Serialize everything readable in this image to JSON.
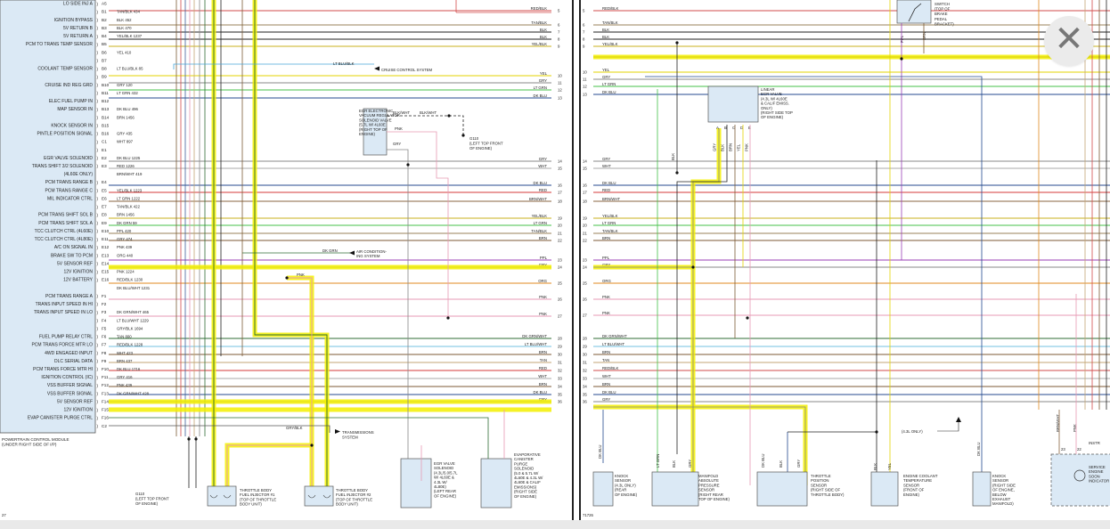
{
  "viewer": {
    "close_icon": "close-icon",
    "close_glyph": "✕"
  },
  "left": {
    "pcm_labels": [
      {
        "t": "LO SIDE INJ A",
        "pin": "A5"
      },
      {
        "t": "",
        "pin": "B1"
      },
      {
        "t": "IGNITION BYPASS",
        "pin": "B2"
      },
      {
        "t": "5V RETURN B",
        "pin": "B3"
      },
      {
        "t": "5V RETURN A",
        "pin": "B4"
      },
      {
        "t": "PCM TO TRANS TEMP SENSOR",
        "pin": "B5"
      },
      {
        "t": "",
        "pin": "B6"
      },
      {
        "t": "",
        "pin": "B7"
      },
      {
        "t": "COOLANT TEMP SENSOR",
        "pin": "B8"
      },
      {
        "t": "",
        "pin": "B9"
      },
      {
        "t": "CRUISE IND REG GRD",
        "pin": "B10"
      },
      {
        "t": "",
        "pin": "B11"
      },
      {
        "t": "ELEC FUEL PUMP IN",
        "pin": "B12"
      },
      {
        "t": "MAP SENSOR IN",
        "pin": "B13"
      },
      {
        "t": "",
        "pin": "B14"
      },
      {
        "t": "KNOCK SENSOR IN",
        "pin": "B15"
      },
      {
        "t": "PINTLE POSITION SIGNAL",
        "pin": "B16"
      },
      {
        "t": "",
        "pin": "C1"
      },
      {
        "t": "",
        "pin": "E1"
      },
      {
        "t": "EGR VALVE SOLENOID",
        "pin": "E2"
      },
      {
        "t": "TRANS SHIFT 3/2 SOLENOID",
        "pin": "E3"
      },
      {
        "t": "(4L60E ONLY)",
        "pin": ""
      },
      {
        "t": "PCM TRANS RANGE B",
        "pin": "E4"
      },
      {
        "t": "PCM TRANS RANGE C",
        "pin": "E5"
      },
      {
        "t": "MIL INDICATOR CTRL",
        "pin": "E6"
      },
      {
        "t": "",
        "pin": "E7"
      },
      {
        "t": "PCM TRANS SHIFT SOL B",
        "pin": "E8"
      },
      {
        "t": "PCM TRANS SHIFT SOL A",
        "pin": "E9"
      },
      {
        "t": "TCC CLUTCH CTRL (4L60E)",
        "pin": "E10"
      },
      {
        "t": "TCC CLUTCH CTRL (4L80E)",
        "pin": "E11"
      },
      {
        "t": "A/C ON SIGNAL IN",
        "pin": "E12"
      },
      {
        "t": "BRAKE SW TO PCM",
        "pin": "E13"
      },
      {
        "t": "5V SENSOR REF",
        "pin": "E14"
      },
      {
        "t": "12V IGNITION",
        "pin": "E15"
      },
      {
        "t": "12V BATTERY",
        "pin": "E16"
      },
      {
        "t": "",
        "pin": ""
      },
      {
        "t": "PCM TRANS RANGE A",
        "pin": "F1"
      },
      {
        "t": "TRANS INPUT SPEED IN HI",
        "pin": "F2"
      },
      {
        "t": "TRANS INPUT SPEED IN LO",
        "pin": "F3"
      },
      {
        "t": "",
        "pin": "F4"
      },
      {
        "t": "",
        "pin": "F5"
      },
      {
        "t": "FUEL PUMP RELAY CTRL",
        "pin": "F6"
      },
      {
        "t": "PCM TRANS FORCE MTR LO",
        "pin": "F7"
      },
      {
        "t": "4WD ENGAGED INPUT",
        "pin": "F8"
      },
      {
        "t": "DLC SERIAL DATA",
        "pin": "F9"
      },
      {
        "t": "PCM TRANS FORCE MTR HI",
        "pin": "F10"
      },
      {
        "t": "IGNITION CONTROL (IC)",
        "pin": "F11"
      },
      {
        "t": "VSS BUFFER SIGNAL",
        "pin": "F12"
      },
      {
        "t": "VSS BUFFER SIGNAL",
        "pin": "F13"
      },
      {
        "t": "5V SENSOR REF",
        "pin": "F14"
      },
      {
        "t": "12V IGNITION",
        "pin": "F15"
      },
      {
        "t": "EVAP CANISTER PURGE CTRL",
        "pin": "F16"
      },
      {
        "t": "",
        "pin": "C2"
      }
    ],
    "wire_labels": [
      "TAN/BLK 434",
      "BLK 452",
      "BLK 470",
      "YEL/BLK 1237",
      "",
      "YEL 410",
      "",
      "LT BLU/BLK 85",
      "",
      "GRY 120",
      "LT GRN 432",
      "",
      "DK BLU 496",
      "BRN 1456",
      "",
      "GRY 435",
      "WHT 897",
      "",
      "DK BLU 1225",
      "RED 1226",
      "BRN/WHT 419",
      "",
      "YEL/BLK 1223",
      "LT GRN 1222",
      "TAN/BLK 422",
      "BRN 1456",
      "DK GRN 59",
      "PPL 420",
      "GRY 474",
      "PNK 439",
      "ORG 440",
      "",
      "PNK 1224",
      "RED/BLK 1230",
      "DK BLU/WHT 1231",
      "",
      "",
      "DK GRN/WHT 465",
      "LT BLU/WHT 1229",
      "GRY/BLK 1694",
      "TAN 800",
      "RED/BLK 1228",
      "WHT 423",
      "BRN 437",
      "DK BLU 1716",
      "GRY 416",
      "PNK 439",
      "DK GRN/WHT 428"
    ],
    "right_colors": [
      {
        "c": "RED/BLK",
        "n": "5"
      },
      {
        "c": "TAN/BLK",
        "n": "6"
      },
      {
        "c": "BLK",
        "n": "7"
      },
      {
        "c": "BLK",
        "n": "8"
      },
      {
        "c": "YEL/BLK",
        "n": "9"
      },
      {
        "c": "YEL",
        "n": "10"
      },
      {
        "c": "GRY",
        "n": "11"
      },
      {
        "c": "LT GRN",
        "n": "12"
      },
      {
        "c": "DK BLU",
        "n": "13"
      },
      {
        "c": "GRY",
        "n": "14"
      },
      {
        "c": "WHT",
        "n": "15"
      },
      {
        "c": "DK BLU",
        "n": "16"
      },
      {
        "c": "RED",
        "n": "17"
      },
      {
        "c": "BRN/WHT",
        "n": "18"
      },
      {
        "c": "YEL/BLK",
        "n": "19"
      },
      {
        "c": "LT GRN",
        "n": "20"
      },
      {
        "c": "TAN/BLK",
        "n": "21"
      },
      {
        "c": "BRN",
        "n": "22"
      },
      {
        "c": "PPL",
        "n": "23"
      },
      {
        "c": "GRY",
        "n": "24"
      },
      {
        "c": "ORG",
        "n": "25"
      },
      {
        "c": "PNK",
        "n": "26"
      },
      {
        "c": "PNK",
        "n": "27"
      },
      {
        "c": "DK GRN/WHT",
        "n": "28"
      },
      {
        "c": "LT BLU/WHT",
        "n": "29"
      },
      {
        "c": "BRN",
        "n": "30"
      },
      {
        "c": "TAN",
        "n": "31"
      },
      {
        "c": "RED",
        "n": "32"
      },
      {
        "c": "WHT",
        "n": "33"
      },
      {
        "c": "BRN",
        "n": "34"
      },
      {
        "c": "DK BLU",
        "n": "35"
      },
      {
        "c": "GRY",
        "n": "36"
      }
    ],
    "cruise": "LT BLU/BLK",
    "cruise_sys": "CRUISE CONTROL SYSTEM",
    "egr_vac_title": [
      "EGR ELECTRONIC",
      "VACUUM REGULATOR",
      "SOLENOID VALVE",
      "(5.7L W/ 4L60E",
      "(RIGHT TOP OF",
      "ENGINE)"
    ],
    "blkwht": "BLK/WHT",
    "pnk": "PNK",
    "gry": "GRY",
    "g110_right": [
      "G110",
      "(LEFT TOP FRONT",
      "OF ENGINE)"
    ],
    "dkgrn": "DK GRN",
    "ac_sys": [
      "AIR CONDITION-",
      "ING SYSTEM"
    ],
    "grybk": "GRY/BLK",
    "trans_sys": [
      "TRANSMISSIONS",
      "SYSTEM"
    ],
    "pcm_caption": [
      "POWERTRAIN CONTROL MODULE",
      "(UNDER RIGHT SIDE OF I/P)"
    ],
    "g110_left": [
      "G110",
      "(LEFT TOP FRONT",
      "OF ENGINE)"
    ],
    "inj1": [
      "THROTTLE BODY",
      "FUEL INJECTOR #1",
      "(TOP OF THROTTLE",
      "BODY UNIT)"
    ],
    "inj2": [
      "THROTTLE BODY",
      "FUEL INJECTOR #2",
      "(TOP OF THROTTLE",
      "BODY UNIT)"
    ],
    "egr_sol": [
      "EGR VALVE",
      "SOLENOID",
      "(4.3L/5.0/5.7L",
      "W/ 4L60E &",
      "4.3L W/",
      "4L80E)",
      "(LEFT REAR",
      "OF ENGINE)"
    ],
    "evap": [
      "EVAPORATIVE",
      "CANISTER",
      "PURGE",
      "SOLENOID",
      "(5.0 & 5.7L W/",
      "4L60E & 4.3L W/",
      "4L60E & CALIF",
      "EMISSIONS)",
      "(RIGHT SIDE",
      "OF ENGINE)"
    ],
    "page_num": "27"
  },
  "right": {
    "left_colors": [
      {
        "c": "RED/BLK",
        "n": "5"
      },
      {
        "c": "TAN/BLK",
        "n": "6"
      },
      {
        "c": "BLK",
        "n": "7"
      },
      {
        "c": "BLK",
        "n": "8"
      },
      {
        "c": "YEL/BLK",
        "n": "9"
      },
      {
        "c": "YEL",
        "n": "10"
      },
      {
        "c": "GRY",
        "n": "11"
      },
      {
        "c": "LT GRN",
        "n": "12"
      },
      {
        "c": "DK BLU",
        "n": "13"
      },
      {
        "c": "GRY",
        "n": "14"
      },
      {
        "c": "WHT",
        "n": "15"
      },
      {
        "c": "DK BLU",
        "n": "16"
      },
      {
        "c": "RED",
        "n": "17"
      },
      {
        "c": "BRN/WHT",
        "n": "18"
      },
      {
        "c": "YEL/BLK",
        "n": "19"
      },
      {
        "c": "LT GRN",
        "n": "20"
      },
      {
        "c": "TAN/BLK",
        "n": "21"
      },
      {
        "c": "BRN",
        "n": "22"
      },
      {
        "c": "PPL",
        "n": "23"
      },
      {
        "c": "GRY",
        "n": "24"
      },
      {
        "c": "ORG",
        "n": "25"
      },
      {
        "c": "PNK",
        "n": "26"
      },
      {
        "c": "PNK",
        "n": "27"
      },
      {
        "c": "DK GRN/WHT",
        "n": "28"
      },
      {
        "c": "LT BLU/WHT",
        "n": "29"
      },
      {
        "c": "BRN",
        "n": "30"
      },
      {
        "c": "TAN",
        "n": "31"
      },
      {
        "c": "RED/BLK",
        "n": "32"
      },
      {
        "c": "WHT",
        "n": "33"
      },
      {
        "c": "BRN",
        "n": "34"
      },
      {
        "c": "DK BLU",
        "n": "35"
      },
      {
        "c": "GRY",
        "n": "36"
      }
    ],
    "switch": [
      "SWITCH",
      "(TOP OF",
      "BRAKE",
      "PEDAL",
      "BRACKET)"
    ],
    "ppl": "PPL",
    "brn": "BRN",
    "linear_egr": [
      "LINEAR",
      "EGR VALVE",
      "(4.3L W/ 4L60E",
      "& CALIF EMISS.",
      "ONLY)",
      "(RIGHT SIDE TOP",
      "OF ENGINE)"
    ],
    "egr_pins": [
      "A",
      "B",
      "C",
      "D",
      "E"
    ],
    "egr_wires": [
      "GRY",
      "BLK",
      "BRN",
      "YEL",
      "PNK"
    ],
    "blk": "BLK",
    "knock1": [
      "KNOCK",
      "SENSOR",
      "(4.3L ONLY)",
      "(REAR",
      "OF ENGINE)"
    ],
    "dkblu": "DK BLU",
    "map": [
      "MANIFOLD",
      "ABSOLUTE",
      "PRESSURE",
      "SENSOR",
      "(RIGHT REAR",
      "TOP OF ENGINE)"
    ],
    "map_wires": [
      "LT GRN",
      "BLK",
      "GRY"
    ],
    "tps": [
      "THROTTLE",
      "POSITION",
      "SENSOR",
      "(RIGHT SIDE OF",
      "THROTTLE BODY)"
    ],
    "tps_wires": [
      "DK BLU",
      "BLK",
      "GRY"
    ],
    "ect": [
      "ENGINE COOLANT",
      "TEMPERATURE",
      "SENSOR",
      "(FRONT OF",
      "ENGINE)"
    ],
    "ect_wires": [
      "BLK",
      "YEL"
    ],
    "only43": "(4.3L ONLY)",
    "knock2": [
      "KNOCK",
      "SENSOR",
      "(RIGHT SIDE",
      "OF ENGINE,",
      "BELOW",
      "EXHAUST",
      "MANIFOLD)"
    ],
    "svc": [
      "SERVICE",
      "ENGINE",
      "SOON",
      "INDICATOR"
    ],
    "instr": "INSTR",
    "brnwht": "BRN/WHT",
    "pnk": "PNK",
    "n23": "23",
    "n22": "22",
    "figure_id": "71726"
  }
}
